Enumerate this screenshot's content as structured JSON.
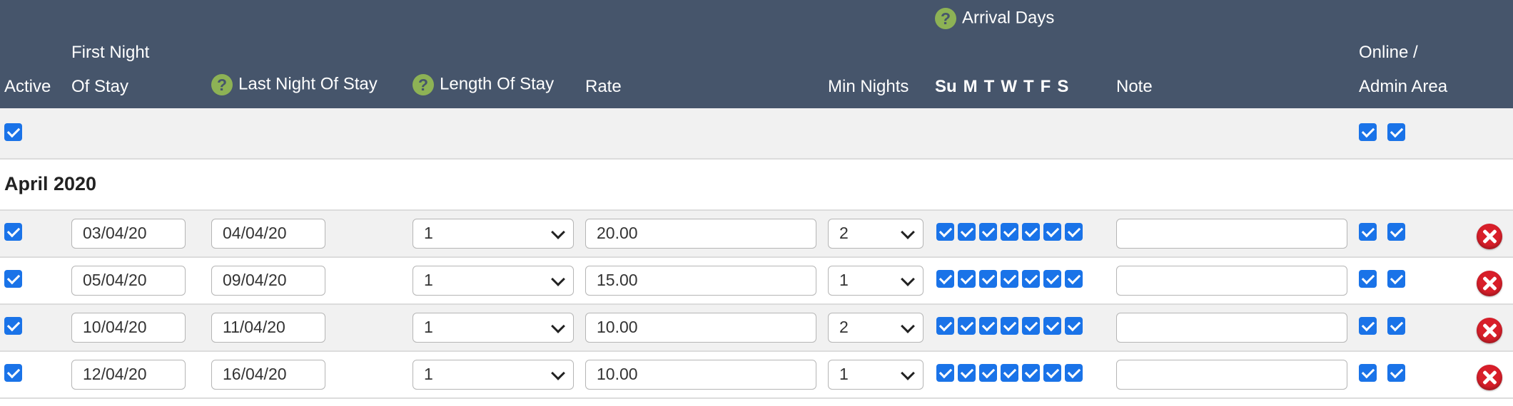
{
  "header": {
    "arrival_days_title": "Arrival Days",
    "columns": {
      "active": "Active",
      "first_night_line1": "First Night",
      "first_night_line2": "Of Stay",
      "last_night": "Last Night Of Stay",
      "length_of_stay": "Length Of Stay",
      "rate": "Rate",
      "min_nights": "Min Nights",
      "note": "Note",
      "online_line1": "Online /",
      "online_line2": "Admin Area"
    },
    "help_icon_glyph": "?",
    "days": [
      "Su",
      "M",
      "T",
      "W",
      "T",
      "F",
      "S"
    ]
  },
  "master_row": {
    "active": true,
    "online": true,
    "admin": true
  },
  "month_label": "April 2020",
  "rows": [
    {
      "active": true,
      "first_night": "03/04/20",
      "last_night": "04/04/20",
      "length_of_stay": "1",
      "rate": "20.00",
      "min_nights": "2",
      "days": [
        true,
        true,
        true,
        true,
        true,
        true,
        true
      ],
      "note": "",
      "online": true,
      "admin": true
    },
    {
      "active": true,
      "first_night": "05/04/20",
      "last_night": "09/04/20",
      "length_of_stay": "1",
      "rate": "15.00",
      "min_nights": "1",
      "days": [
        true,
        true,
        true,
        true,
        true,
        true,
        true
      ],
      "note": "",
      "online": true,
      "admin": true
    },
    {
      "active": true,
      "first_night": "10/04/20",
      "last_night": "11/04/20",
      "length_of_stay": "1",
      "rate": "10.00",
      "min_nights": "2",
      "days": [
        true,
        true,
        true,
        true,
        true,
        true,
        true
      ],
      "note": "",
      "online": true,
      "admin": true
    },
    {
      "active": true,
      "first_night": "12/04/20",
      "last_night": "16/04/20",
      "length_of_stay": "1",
      "rate": "10.00",
      "min_nights": "1",
      "days": [
        true,
        true,
        true,
        true,
        true,
        true,
        true
      ],
      "note": "",
      "online": true,
      "admin": true
    }
  ],
  "colors": {
    "header_bg": "#46556b",
    "help_icon": "#8db255",
    "checkbox": "#1a73e8",
    "delete_icon": "#d81f2a",
    "row_alt_bg": "#f1f1f1"
  },
  "icons": {
    "help": "help-icon",
    "delete": "delete-icon",
    "dropdown": "chevron-down-icon"
  }
}
